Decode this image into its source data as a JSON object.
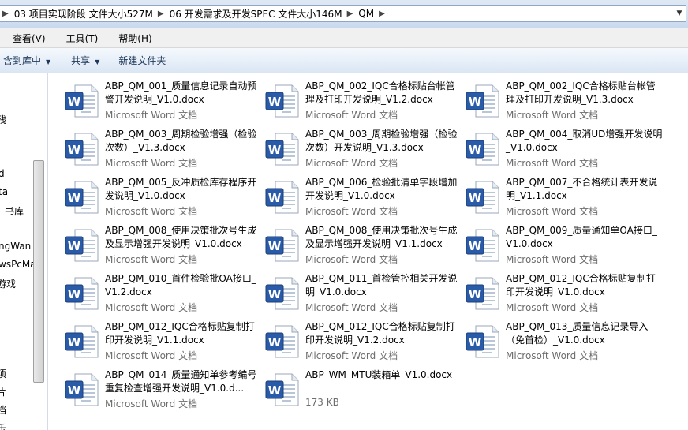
{
  "address": {
    "crumbs": [
      "03 项目实现阶段 文件大小527M",
      "06 开发需求及开发SPEC 文件大小146M",
      "QM"
    ]
  },
  "menu": [
    "查看(V)",
    "工具(T)",
    "帮助(H)"
  ],
  "toolbar": {
    "include_label": "含到库中",
    "share_label": "共享",
    "new_folder_label": "新建文件夹"
  },
  "nav": [
    "残",
    "d",
    "ta",
    "书库",
    "ngWan",
    "wsPcMa",
    "游戏",
    "项",
    "片",
    "档",
    "乐"
  ],
  "files": [
    {
      "name": "ABP_QM_001_质量信息记录自动预警开发说明_V1.0.docx",
      "type": "Microsoft Word 文档"
    },
    {
      "name": "ABP_QM_002_IQC合格标贴台帐管理及打印开发说明_V1.2.docx",
      "type": "Microsoft Word 文档"
    },
    {
      "name": "ABP_QM_002_IQC合格标贴台帐管理及打印开发说明_V1.3.docx",
      "type": "Microsoft Word 文档"
    },
    {
      "name": "ABP_QM_003_周期检验增强（检验次数）_V1.3.docx",
      "type": "Microsoft Word 文档"
    },
    {
      "name": "ABP_QM_003_周期检验增强（检验次数）开发说明_V1.3.docx",
      "type": "Microsoft Word 文档"
    },
    {
      "name": "ABP_QM_004_取消UD增强开发说明_V1.0.docx",
      "type": "Microsoft Word 文档"
    },
    {
      "name": "ABP_QM_005_反冲质检库存程序开发说明_V1.0.docx",
      "type": "Microsoft Word 文档"
    },
    {
      "name": "ABP_QM_006_检验批清单字段增加开发说明_V1.0.docx",
      "type": "Microsoft Word 文档"
    },
    {
      "name": "ABP_QM_007_不合格统计表开发说明_V1.1.docx",
      "type": "Microsoft Word 文档"
    },
    {
      "name": "ABP_QM_008_使用决策批次号生成及显示增强开发说明_V1.0.docx",
      "type": "Microsoft Word 文档"
    },
    {
      "name": "ABP_QM_008_使用决策批次号生成及显示增强开发说明_V1.1.docx",
      "type": "Microsoft Word 文档"
    },
    {
      "name": "ABP_QM_009_质量通知单OA接口_V1.0.docx",
      "type": "Microsoft Word 文档"
    },
    {
      "name": "ABP_QM_010_首件检验批OA接口_V1.2.docx",
      "type": "Microsoft Word 文档"
    },
    {
      "name": "ABP_QM_011_首检管控相关开发说明_V1.0.docx",
      "type": "Microsoft Word 文档"
    },
    {
      "name": "ABP_QM_012_IQC合格标贴复制打印开发说明_V1.0.docx",
      "type": "Microsoft Word 文档"
    },
    {
      "name": "ABP_QM_012_IQC合格标贴复制打印开发说明_V1.1.docx",
      "type": "Microsoft Word 文档"
    },
    {
      "name": "ABP_QM_012_IQC合格标贴复制打印开发说明_V1.2.docx",
      "type": "Microsoft Word 文档"
    },
    {
      "name": "ABP_QM_013_质量信息记录导入（免首检）_V1.0.docx",
      "type": "Microsoft Word 文档"
    },
    {
      "name": "ABP_QM_014_质量通知单参考编号重复检查增强开发说明_V1.0.d...",
      "type": "Microsoft Word 文档"
    },
    {
      "name": "ABP_WM_MTU装箱单_V1.0.docx",
      "type": "173 KB"
    }
  ]
}
